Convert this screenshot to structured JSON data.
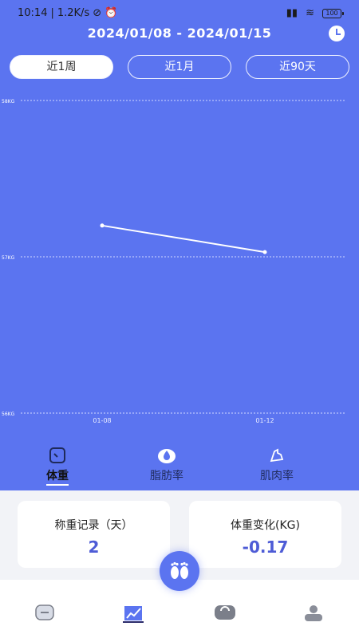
{
  "status": {
    "time": "10:14",
    "speed": "1.2K/s",
    "battery": "100"
  },
  "header": {
    "date_range": "2024/01/08 - 2024/01/15",
    "icons": {
      "clock": "clock-icon"
    }
  },
  "range_tabs": [
    {
      "label": "近1周",
      "active": true
    },
    {
      "label": "近1月",
      "active": false
    },
    {
      "label": "近90天",
      "active": false
    }
  ],
  "chart_data": {
    "type": "line",
    "x": [
      "01-08",
      "01-12"
    ],
    "series": [
      {
        "values": [
          57.2,
          57.03
        ]
      }
    ],
    "ylim": [
      56,
      58
    ],
    "yticks": [
      "58KG",
      "57KG",
      "56KG"
    ],
    "xticks": [
      "01-08",
      "01-12"
    ],
    "grid": true,
    "colors": {
      "line": "#ffffff",
      "grid": "#d0d7ff"
    }
  },
  "metric_tabs": [
    {
      "label": "体重",
      "icon": "scale-icon",
      "active": true
    },
    {
      "label": "脂肪率",
      "icon": "droplet-icon",
      "active": false
    },
    {
      "label": "肌肉率",
      "icon": "muscle-icon",
      "active": false
    }
  ],
  "cards": [
    {
      "title": "称重记录（天）",
      "value": "2"
    },
    {
      "title": "体重变化(KG)",
      "value": "-0.17"
    }
  ],
  "fab": {
    "icon": "footprints-icon"
  },
  "bottom_nav": [
    {
      "icon": "home-icon"
    },
    {
      "icon": "chart-icon"
    },
    {
      "icon": "scale-icon"
    },
    {
      "icon": "profile-icon"
    }
  ],
  "colors": {
    "primary": "#5b74f0",
    "accent_text": "#4e5cd6",
    "background": "#f2f3f7"
  }
}
